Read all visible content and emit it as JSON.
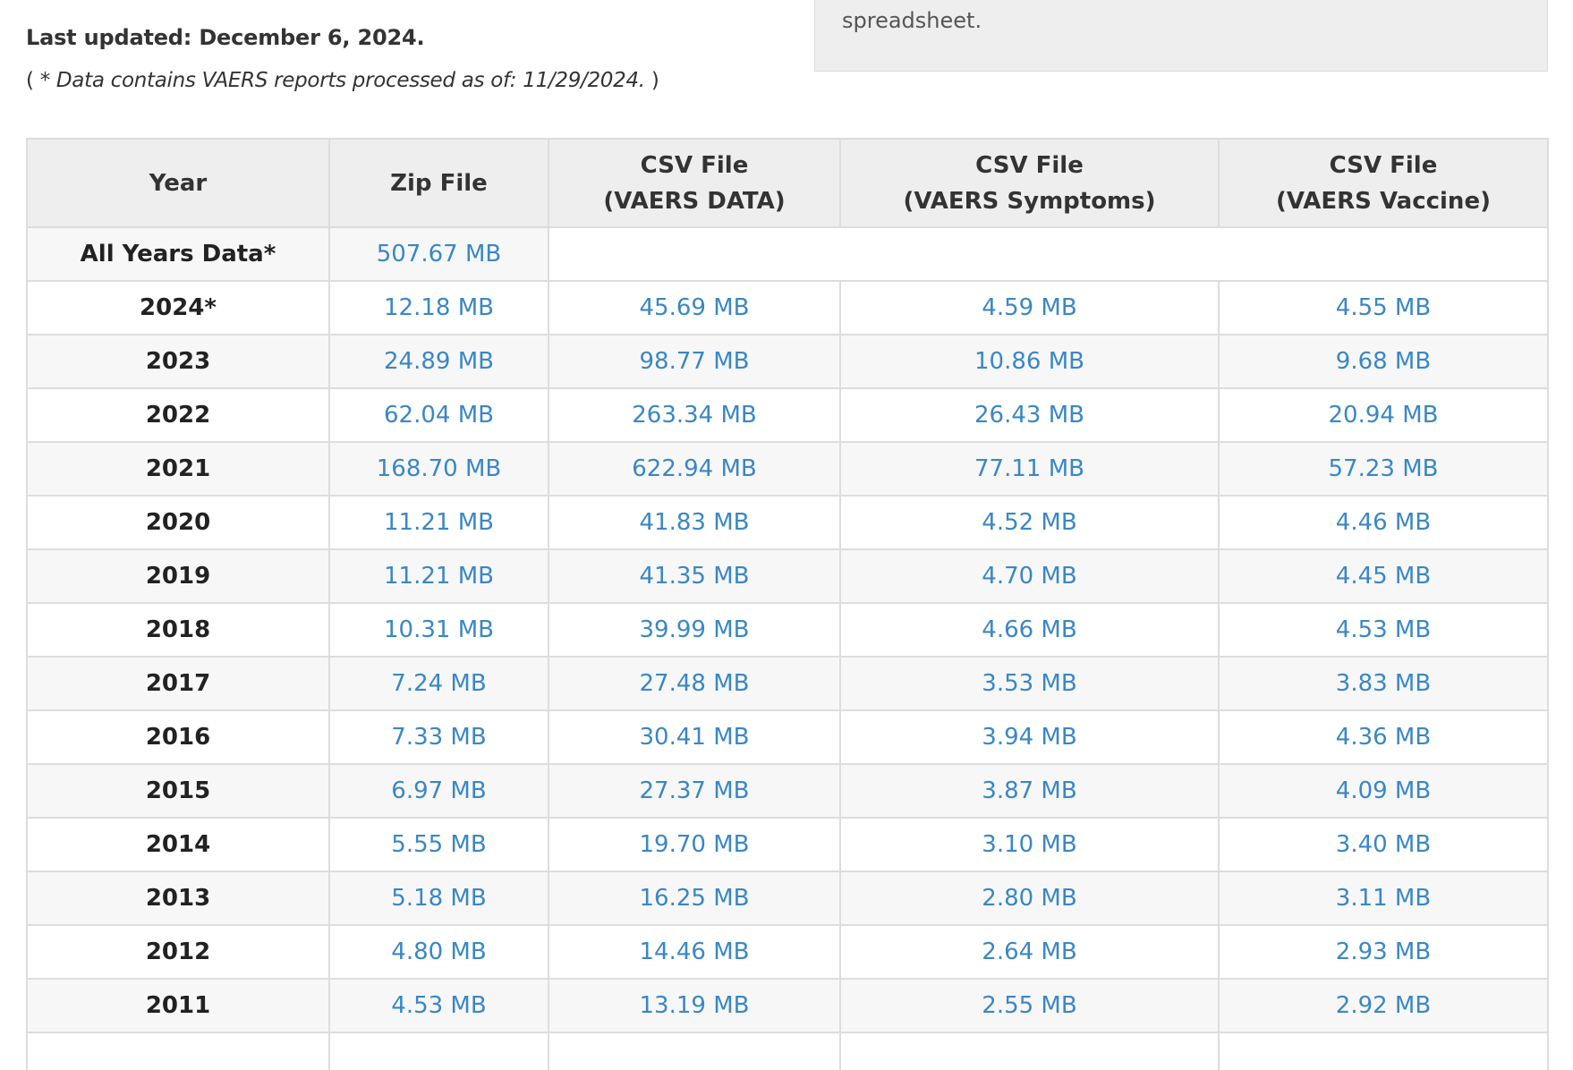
{
  "header": {
    "last_updated": "Last updated: December 6, 2024.",
    "note_open": "( ",
    "note_text": "* Data contains VAERS reports processed as of: 11/29/2024.",
    "note_close": " )"
  },
  "info_box": {
    "text": "spreadsheet."
  },
  "table": {
    "headers": {
      "year": "Year",
      "zip": "Zip File",
      "csv_data_line1": "CSV File",
      "csv_data_line2": "(VAERS DATA)",
      "csv_symptoms_line1": "CSV File",
      "csv_symptoms_line2": "(VAERS Symptoms)",
      "csv_vaccine_line1": "CSV File",
      "csv_vaccine_line2": "(VAERS Vaccine)"
    },
    "all_years": {
      "label": "All Years Data*",
      "zip": "507.67 MB"
    },
    "rows": [
      {
        "year": "2024*",
        "zip": "12.18 MB",
        "data": "45.69 MB",
        "symptoms": "4.59 MB",
        "vaccine": "4.55 MB"
      },
      {
        "year": "2023",
        "zip": "24.89 MB",
        "data": "98.77 MB",
        "symptoms": "10.86 MB",
        "vaccine": "9.68 MB"
      },
      {
        "year": "2022",
        "zip": "62.04 MB",
        "data": "263.34 MB",
        "symptoms": "26.43 MB",
        "vaccine": "20.94 MB"
      },
      {
        "year": "2021",
        "zip": "168.70 MB",
        "data": "622.94 MB",
        "symptoms": "77.11 MB",
        "vaccine": "57.23 MB"
      },
      {
        "year": "2020",
        "zip": "11.21 MB",
        "data": "41.83 MB",
        "symptoms": "4.52 MB",
        "vaccine": "4.46 MB"
      },
      {
        "year": "2019",
        "zip": "11.21 MB",
        "data": "41.35 MB",
        "symptoms": "4.70 MB",
        "vaccine": "4.45 MB"
      },
      {
        "year": "2018",
        "zip": "10.31 MB",
        "data": "39.99 MB",
        "symptoms": "4.66 MB",
        "vaccine": "4.53 MB"
      },
      {
        "year": "2017",
        "zip": "7.24 MB",
        "data": "27.48 MB",
        "symptoms": "3.53 MB",
        "vaccine": "3.83 MB"
      },
      {
        "year": "2016",
        "zip": "7.33 MB",
        "data": "30.41 MB",
        "symptoms": "3.94 MB",
        "vaccine": "4.36 MB"
      },
      {
        "year": "2015",
        "zip": "6.97 MB",
        "data": "27.37 MB",
        "symptoms": "3.87 MB",
        "vaccine": "4.09 MB"
      },
      {
        "year": "2014",
        "zip": "5.55 MB",
        "data": "19.70 MB",
        "symptoms": "3.10 MB",
        "vaccine": "3.40 MB"
      },
      {
        "year": "2013",
        "zip": "5.18 MB",
        "data": "16.25 MB",
        "symptoms": "2.80 MB",
        "vaccine": "3.11 MB"
      },
      {
        "year": "2012",
        "zip": "4.80 MB",
        "data": "14.46 MB",
        "symptoms": "2.64 MB",
        "vaccine": "2.93 MB"
      },
      {
        "year": "2011",
        "zip": "4.53 MB",
        "data": "13.19 MB",
        "symptoms": "2.55 MB",
        "vaccine": "2.92 MB"
      },
      {
        "year": "",
        "zip": "",
        "data": "",
        "symptoms": "",
        "vaccine": ""
      }
    ]
  },
  "colors": {
    "link": "#3a87c5",
    "header_bg": "#eeeeee",
    "stripe_bg": "#f7f7f7",
    "border": "#dddddd"
  }
}
